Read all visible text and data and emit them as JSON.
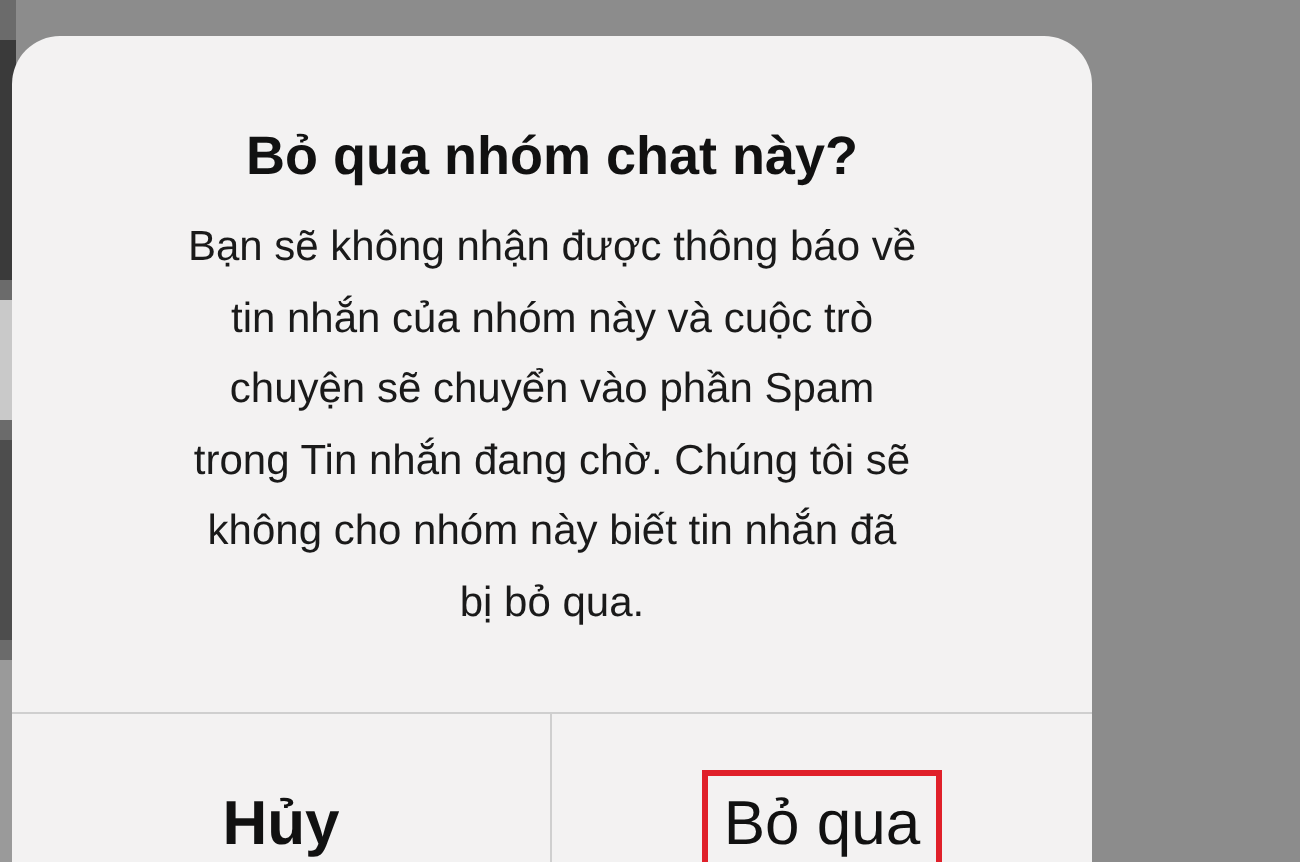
{
  "alert": {
    "title": "Bỏ qua nhóm chat này?",
    "message_lines": [
      "Bạn sẽ không nhận được thông báo về",
      "tin nhắn của nhóm này và cuộc trò",
      "chuyện sẽ chuyển vào phần Spam",
      "trong Tin nhắn đang chờ. Chúng tôi sẽ",
      "không cho nhóm này biết tin nhắn đã",
      "bị bỏ qua."
    ],
    "buttons": [
      {
        "label": "Hủy",
        "kind": "cancel",
        "highlighted": false
      },
      {
        "label": "Bỏ qua",
        "kind": "default",
        "highlighted": true
      }
    ]
  }
}
